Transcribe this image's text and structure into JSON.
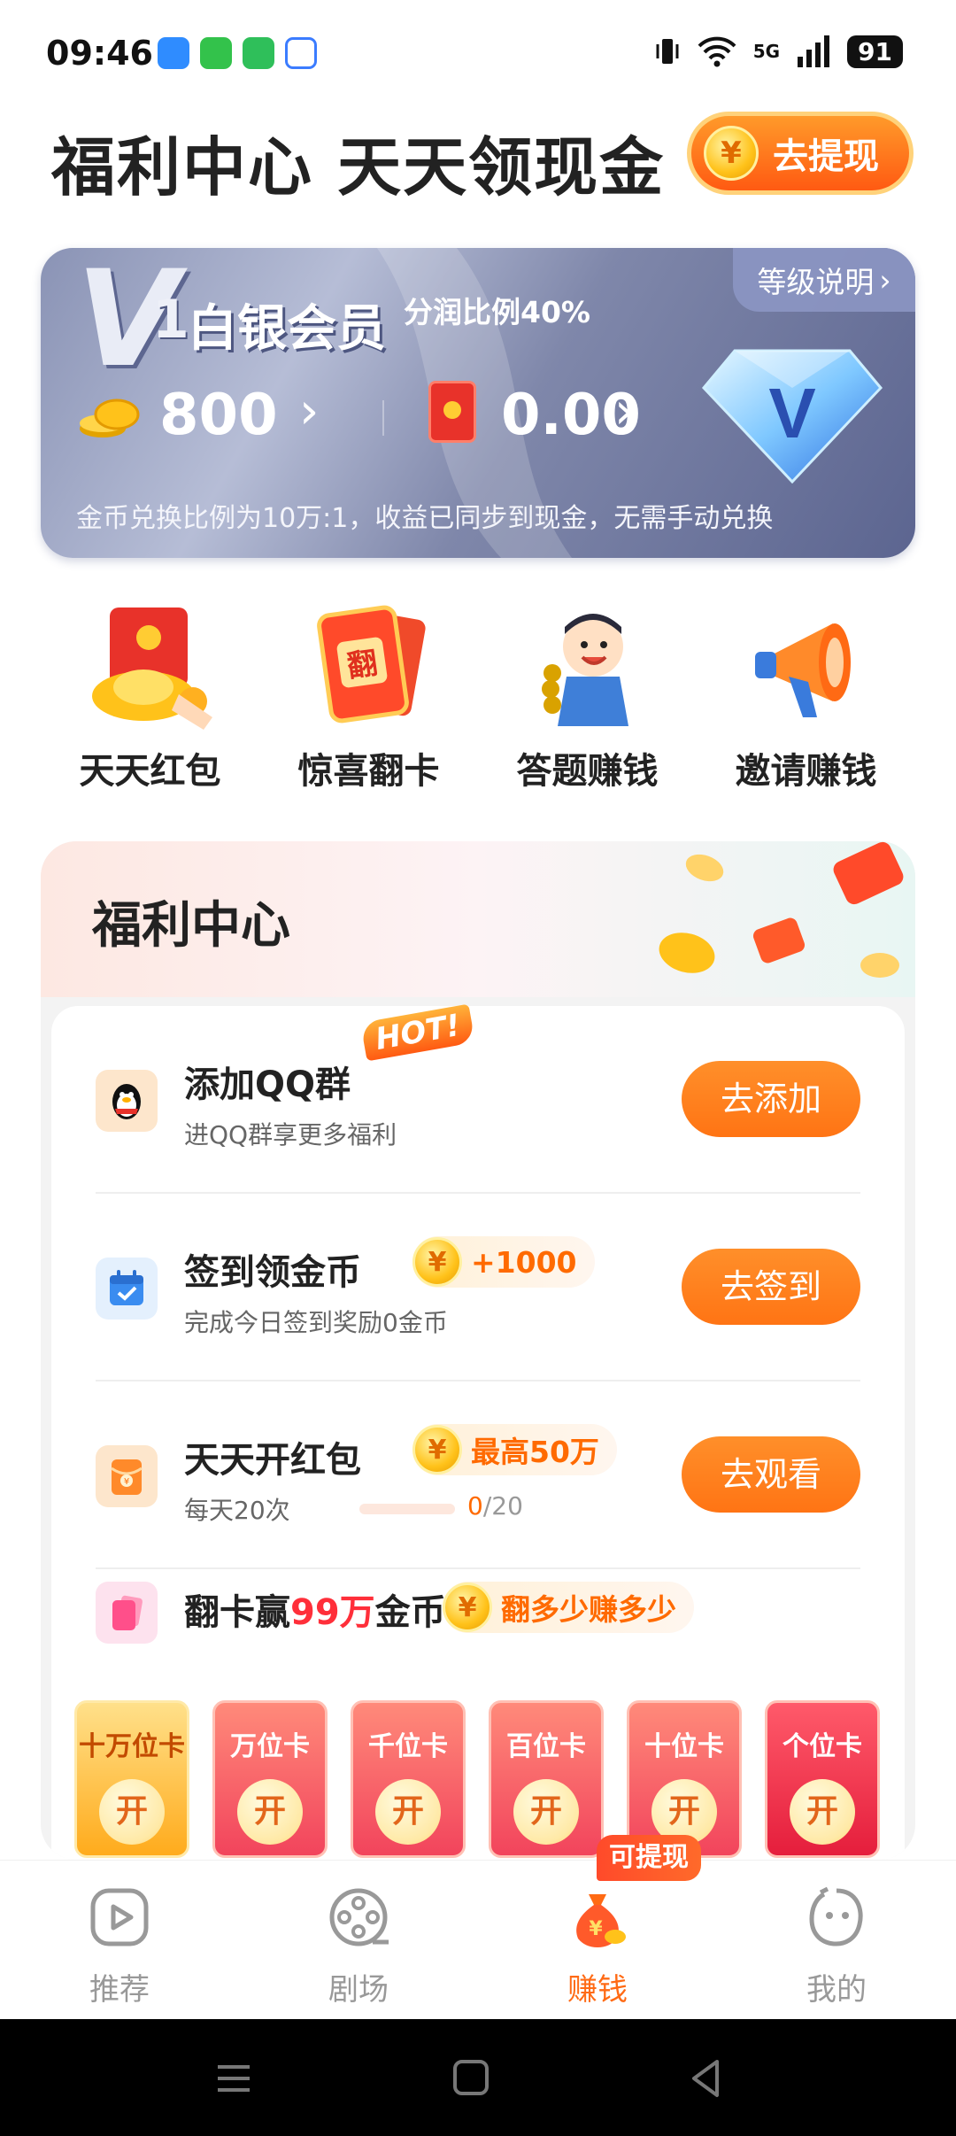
{
  "status": {
    "time": "09:46",
    "network": "5G",
    "battery": "91"
  },
  "header": {
    "title": "福利中心 天天领现金",
    "withdraw_label": "去提现",
    "coin_symbol": "¥"
  },
  "vip": {
    "level_num": "1",
    "level_name": "白银会员",
    "ratio_text": "分润比例40%",
    "explain_label": "等级说明",
    "coins": "800",
    "cash": "0.00",
    "note": "金币兑换比例为10万:1，收益已同步到现金，无需手动兑换"
  },
  "quick": [
    {
      "label": "天天红包",
      "icon": "red-envelope-icon"
    },
    {
      "label": "惊喜翻卡",
      "icon": "flip-card-icon"
    },
    {
      "label": "答题赚钱",
      "icon": "quiz-character-icon"
    },
    {
      "label": "邀请赚钱",
      "icon": "megaphone-icon"
    }
  ],
  "welfare": {
    "title": "福利中心",
    "tasks": [
      {
        "title": "添加QQ群",
        "badge": "HOT!",
        "subtitle": "进QQ群享更多福利",
        "button": "去添加",
        "icon": "qq-penguin-icon"
      },
      {
        "title": "签到领金币",
        "reward": "+1000",
        "subtitle": "完成今日签到奖励0金币",
        "button": "去签到",
        "icon": "calendar-check-icon"
      },
      {
        "title": "天天开红包",
        "reward": "最高50万",
        "subtitle": "每天20次",
        "progress_current": "0",
        "progress_total": "/20",
        "progress_fraction": 0,
        "button": "去观看",
        "icon": "red-envelope-icon"
      }
    ],
    "flip": {
      "title_prefix": "翻卡赢",
      "title_highlight": "99万",
      "title_suffix": "金币",
      "reward": "翻多少赚多少",
      "cards": [
        "十万位卡",
        "万位卡",
        "千位卡",
        "百位卡",
        "十位卡",
        "个位卡"
      ],
      "open_label": "开"
    }
  },
  "nav": {
    "items": [
      {
        "label": "推荐",
        "icon": "play-icon"
      },
      {
        "label": "剧场",
        "icon": "film-reel-icon"
      },
      {
        "label": "赚钱",
        "icon": "money-bag-icon"
      },
      {
        "label": "我的",
        "icon": "profile-face-icon"
      }
    ],
    "withdraw_tag": "可提现"
  },
  "colors": {
    "accent": "#ff7414",
    "highlight": "#ff2f3a",
    "reward": "#ff6a00"
  }
}
